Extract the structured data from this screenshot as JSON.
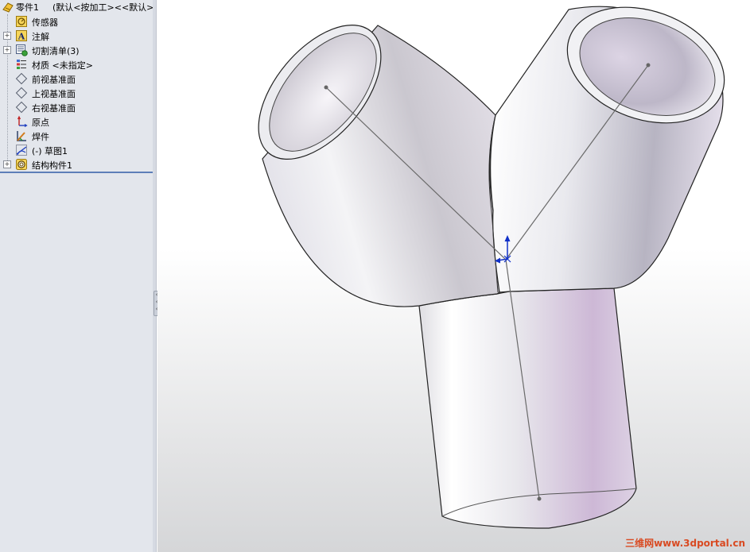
{
  "feature_tree": {
    "root": {
      "label": "零件1",
      "config": "(默认<按加工><<默认>_"
    },
    "items": [
      {
        "label": "传感器",
        "icon": "sensor-icon",
        "expandable": false
      },
      {
        "label": "注解",
        "icon": "annotation-icon",
        "expandable": true
      },
      {
        "label": "切割清单(3)",
        "icon": "cut-list-icon",
        "expandable": true
      },
      {
        "label": "材质 <未指定>",
        "icon": "material-icon",
        "expandable": false
      },
      {
        "label": "前视基准面",
        "icon": "plane-icon",
        "expandable": false
      },
      {
        "label": "上视基准面",
        "icon": "plane-icon",
        "expandable": false
      },
      {
        "label": "右视基准面",
        "icon": "plane-icon",
        "expandable": false
      },
      {
        "label": "原点",
        "icon": "origin-icon",
        "expandable": false
      },
      {
        "label": "焊件",
        "icon": "weldment-icon",
        "expandable": false
      },
      {
        "label": "(-) 草图1",
        "icon": "sketch-icon",
        "expandable": false
      },
      {
        "label": "结构构件1",
        "icon": "structural-member-icon",
        "expandable": true
      }
    ]
  },
  "viewport": {
    "model": "Y-shaped pipe weldment",
    "watermark": "三维网www.3dportal.cn"
  }
}
